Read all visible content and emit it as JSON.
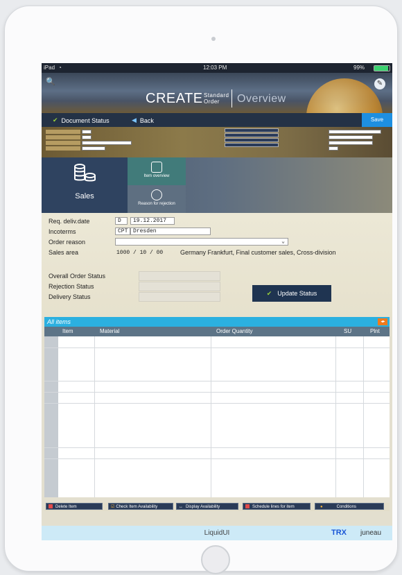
{
  "device": {
    "home_button": "home-button"
  },
  "statusbar": {
    "device": "iPad",
    "wifi": "◔",
    "time": "12:03 PM",
    "battery": "99%"
  },
  "banner": {
    "title": "CREATE",
    "subtitle_top": "Standard",
    "subtitle_bottom": "Order",
    "view": "Overview",
    "search_icon": "🔍",
    "edit_icon": "✎"
  },
  "toolbar": {
    "document_status": "Document Status",
    "back": "Back",
    "save": "Save"
  },
  "nav": {
    "sales": "Sales",
    "item_overview": "Item overview",
    "reason_for_rejection": "Reason for rejection"
  },
  "form": {
    "req_deliv_date_label": "Req. deliv.date",
    "req_deliv_type": "D",
    "req_deliv_date": "19.12.2017",
    "incoterms_label": "Incoterms",
    "incoterms_code": "CPT",
    "incoterms_place": "Dresden",
    "order_reason_label": "Order reason",
    "order_reason_value": "",
    "sales_area_label": "Sales area",
    "sales_area_values": "1000  /  10  /  00",
    "sales_area_desc": "Germany Frankfurt, Final customer sales, Cross-division",
    "overall_status_label": "Overall Order Status",
    "rejection_status_label": "Rejection Status",
    "delivery_status_label": "Delivery Status",
    "update_status": "Update Status"
  },
  "table": {
    "title": "All items",
    "columns": [
      "Item",
      "Material",
      "Order Quantity",
      "SU",
      "Plnt"
    ]
  },
  "actions": [
    "Delete Item",
    "Check Item Availability",
    "Display Availability",
    "Schedule lines for item",
    "Conditions"
  ],
  "footer": {
    "brand": "LiquidUI",
    "trx": "TRX",
    "user": "juneau"
  },
  "colors": {
    "accent": "#1e8fe0",
    "table_header": "#2bb0e0",
    "dark": "#243246"
  }
}
